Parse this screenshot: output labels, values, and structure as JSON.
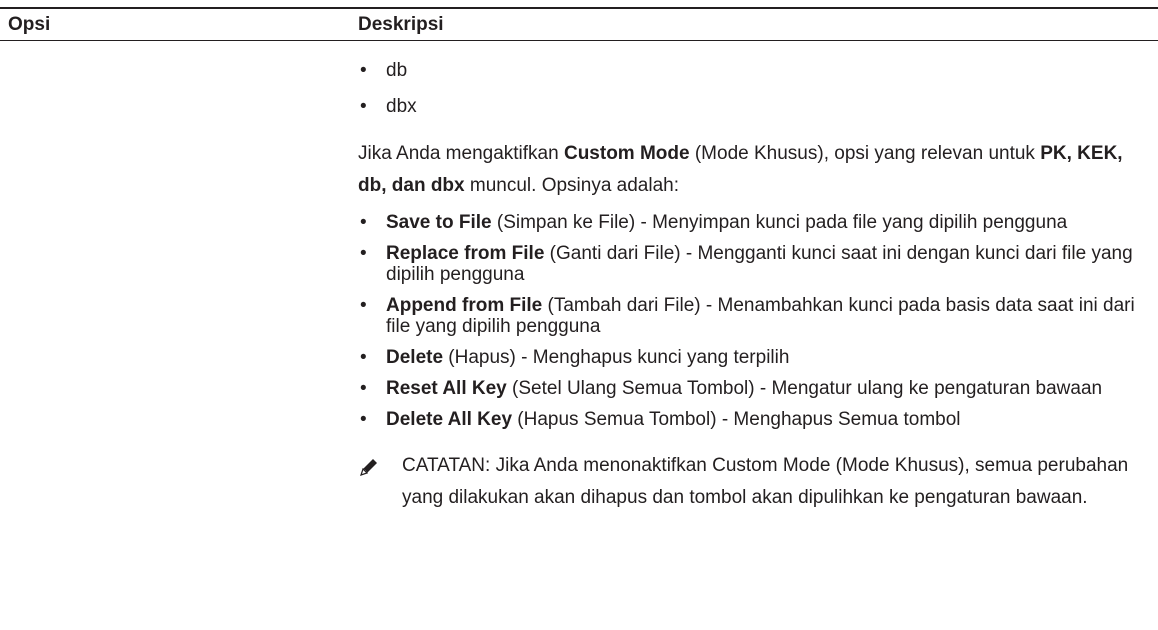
{
  "table": {
    "header_option": "Opsi",
    "header_description": "Deskripsi"
  },
  "simple_list": [
    "db",
    "dbx"
  ],
  "paragraph": {
    "p1": "Jika Anda mengaktifkan ",
    "b1": "Custom Mode",
    "p2": " (Mode Khusus), opsi yang relevan untuk ",
    "b2": "PK, KEK, db, dan dbx",
    "p3": " muncul. Opsinya adalah:"
  },
  "options": [
    {
      "name": "Save to File",
      "desc": " (Simpan ke File) - Menyimpan kunci pada file yang dipilih pengguna"
    },
    {
      "name": "Replace from File",
      "desc": " (Ganti dari File) - Mengganti kunci saat ini dengan kunci dari file yang dipilih pengguna"
    },
    {
      "name": "Append from File",
      "desc": " (Tambah dari File) - Menambahkan kunci pada basis data saat ini dari file yang dipilih pengguna"
    },
    {
      "name": "Delete",
      "desc": " (Hapus) - Menghapus kunci yang terpilih"
    },
    {
      "name": "Reset All Key",
      "desc": " (Setel Ulang Semua Tombol) - Mengatur ulang ke pengaturan bawaan"
    },
    {
      "name": "Delete All Key",
      "desc": " (Hapus Semua Tombol) - Menghapus Semua tombol"
    }
  ],
  "note": {
    "icon": "pencil-icon",
    "label": "CATATAN:",
    "text": " Jika Anda menonaktifkan Custom Mode (Mode Khusus), semua perubahan yang dilakukan akan dihapus dan tombol akan dipulihkan ke pengaturan bawaan."
  }
}
